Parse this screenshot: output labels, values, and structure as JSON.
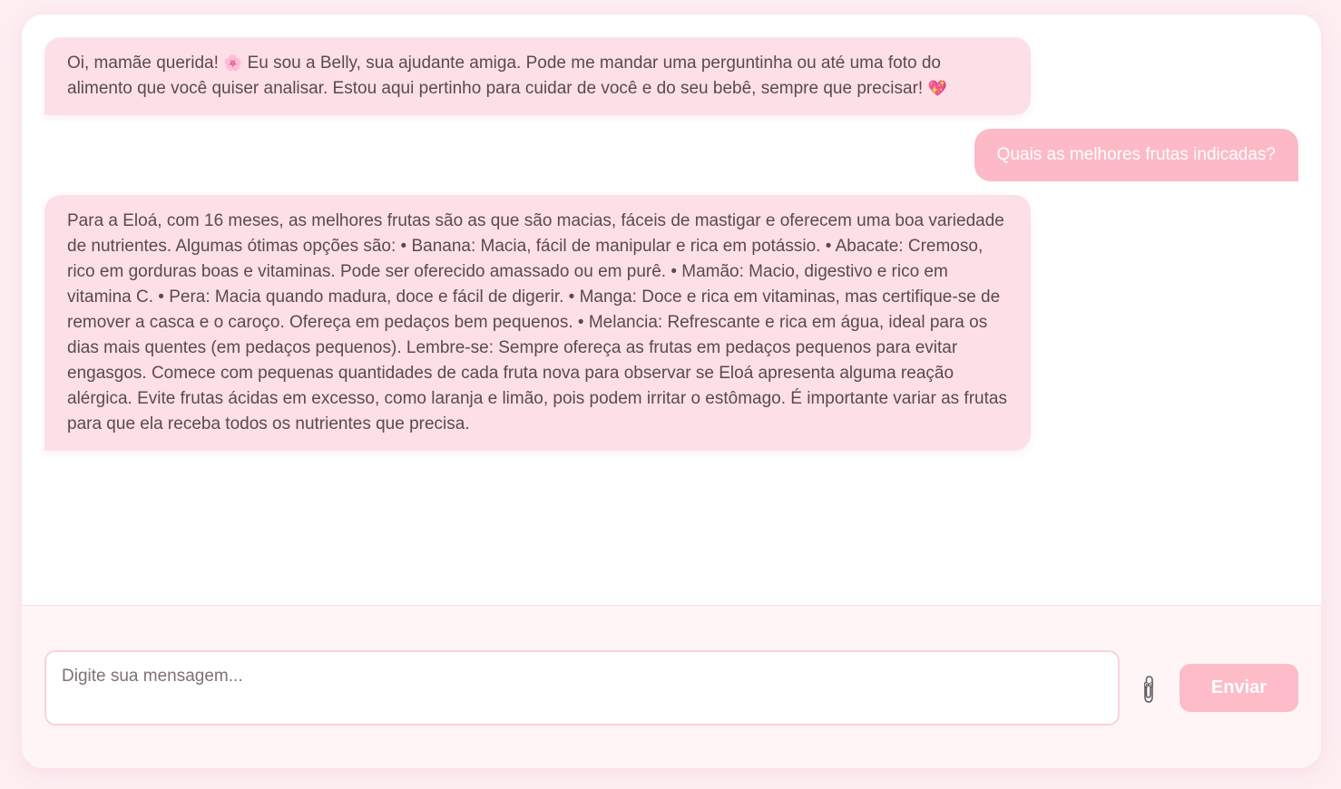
{
  "messages": [
    {
      "sender": "bot",
      "text_before_emoji": "Oi, mamãe querida! ",
      "emoji_flower": "🌸",
      "text_after_emoji": " Eu sou a Belly, sua ajudante amiga. Pode me mandar uma perguntinha ou até uma foto do alimento que você quiser analisar. Estou aqui pertinho para cuidar de você e do seu bebê, sempre que precisar! ",
      "emoji_heart": "💖"
    },
    {
      "sender": "user",
      "text": "Quais as melhores frutas indicadas?"
    },
    {
      "sender": "bot",
      "text": "Para a Eloá, com 16 meses, as melhores frutas são as que são macias, fáceis de mastigar e oferecem uma boa variedade de nutrientes. Algumas ótimas opções são: • Banana: Macia, fácil de manipular e rica em potássio. • Abacate: Cremoso, rico em gorduras boas e vitaminas. Pode ser oferecido amassado ou em purê. • Mamão: Macio, digestivo e rico em vitamina C. • Pera: Macia quando madura, doce e fácil de digerir. • Manga: Doce e rica em vitaminas, mas certifique-se de remover a casca e o caroço. Ofereça em pedaços bem pequenos. • Melancia: Refrescante e rica em água, ideal para os dias mais quentes (em pedaços pequenos). Lembre-se: Sempre ofereça as frutas em pedaços pequenos para evitar engasgos. Comece com pequenas quantidades de cada fruta nova para observar se Eloá apresenta alguma reação alérgica. Evite frutas ácidas em excesso, como laranja e limão, pois podem irritar o estômago. É importante variar as frutas para que ela receba todos os nutrientes que precisa."
    }
  ],
  "composer": {
    "placeholder": "Digite sua mensagem...",
    "value": "",
    "attach_icon": "paperclip-icon",
    "send_label": "Enviar"
  },
  "colors": {
    "page_background": "#fdeef2",
    "bot_bubble": "#fde0e7",
    "user_bubble": "#fdb9c6",
    "send_button": "#fdbcc8",
    "text": "#5a4a4e"
  }
}
